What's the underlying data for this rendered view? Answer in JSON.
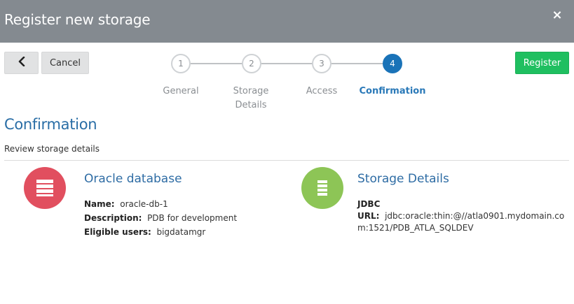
{
  "header": {
    "title": "Register new storage",
    "close_glyph": "×"
  },
  "toolbar": {
    "back_glyph": "❮",
    "cancel_label": "Cancel",
    "register_label": "Register"
  },
  "steps": [
    {
      "number": "1",
      "label": "General"
    },
    {
      "number": "2",
      "label": "Storage Details"
    },
    {
      "number": "3",
      "label": "Access"
    },
    {
      "number": "4",
      "label": "Confirmation"
    }
  ],
  "active_step": 4,
  "section": {
    "title": "Confirmation",
    "subtitle": "Review storage details"
  },
  "cards": {
    "left": {
      "title": "Oracle database",
      "fields": [
        {
          "label": "Name:",
          "value": "oracle-db-1"
        },
        {
          "label": "Description:",
          "value": "PDB for development"
        },
        {
          "label": "Eligible users:",
          "value": "bigdatamgr"
        }
      ],
      "icon": "database-icon",
      "color": "#e14f5f"
    },
    "right": {
      "title": "Storage Details",
      "type": "JDBC",
      "url_label": "URL:",
      "url_value_line1": "jdbc:oracle:thin:@//atla0901.mydomain.co",
      "url_value_line2": "m:1521/PDB_ATLA_SQLDEV",
      "icon": "storage-icon",
      "color": "#8dc556"
    }
  },
  "colors": {
    "header_bg": "#848a90",
    "accent": "#1a73b8",
    "register": "#1fbf60"
  }
}
